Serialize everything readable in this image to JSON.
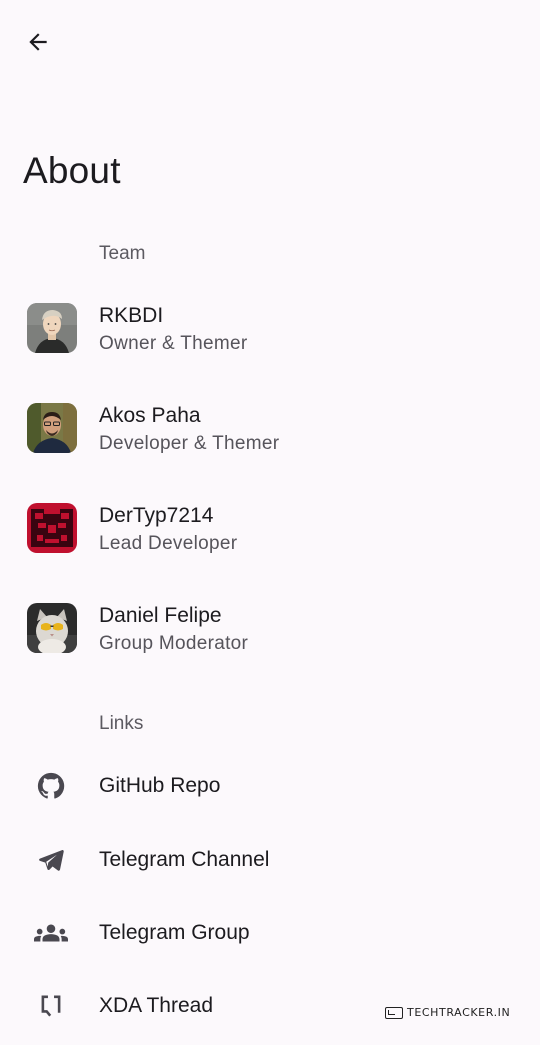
{
  "header": {
    "back_icon": "arrow-back-icon",
    "title": "About"
  },
  "team": {
    "header": "Team",
    "members": [
      {
        "name": "RKBDI",
        "role": "Owner & Themer"
      },
      {
        "name": "Akos Paha",
        "role": "Developer & Themer"
      },
      {
        "name": "DerTyp7214",
        "role": "Lead Developer"
      },
      {
        "name": "Daniel Felipe",
        "role": "Group Moderator"
      }
    ]
  },
  "links": {
    "header": "Links",
    "items": [
      {
        "label": "GitHub Repo",
        "icon": "github-icon"
      },
      {
        "label": "Telegram Channel",
        "icon": "telegram-send-icon"
      },
      {
        "label": "Telegram Group",
        "icon": "group-icon"
      },
      {
        "label": "XDA Thread",
        "icon": "xda-icon"
      }
    ]
  },
  "watermark": {
    "text": "TECHTRACKER.IN"
  },
  "colors": {
    "background": "#fcf9fc",
    "text_primary": "#1c1b1f",
    "text_secondary": "#56545b",
    "icon": "#4a4850"
  }
}
